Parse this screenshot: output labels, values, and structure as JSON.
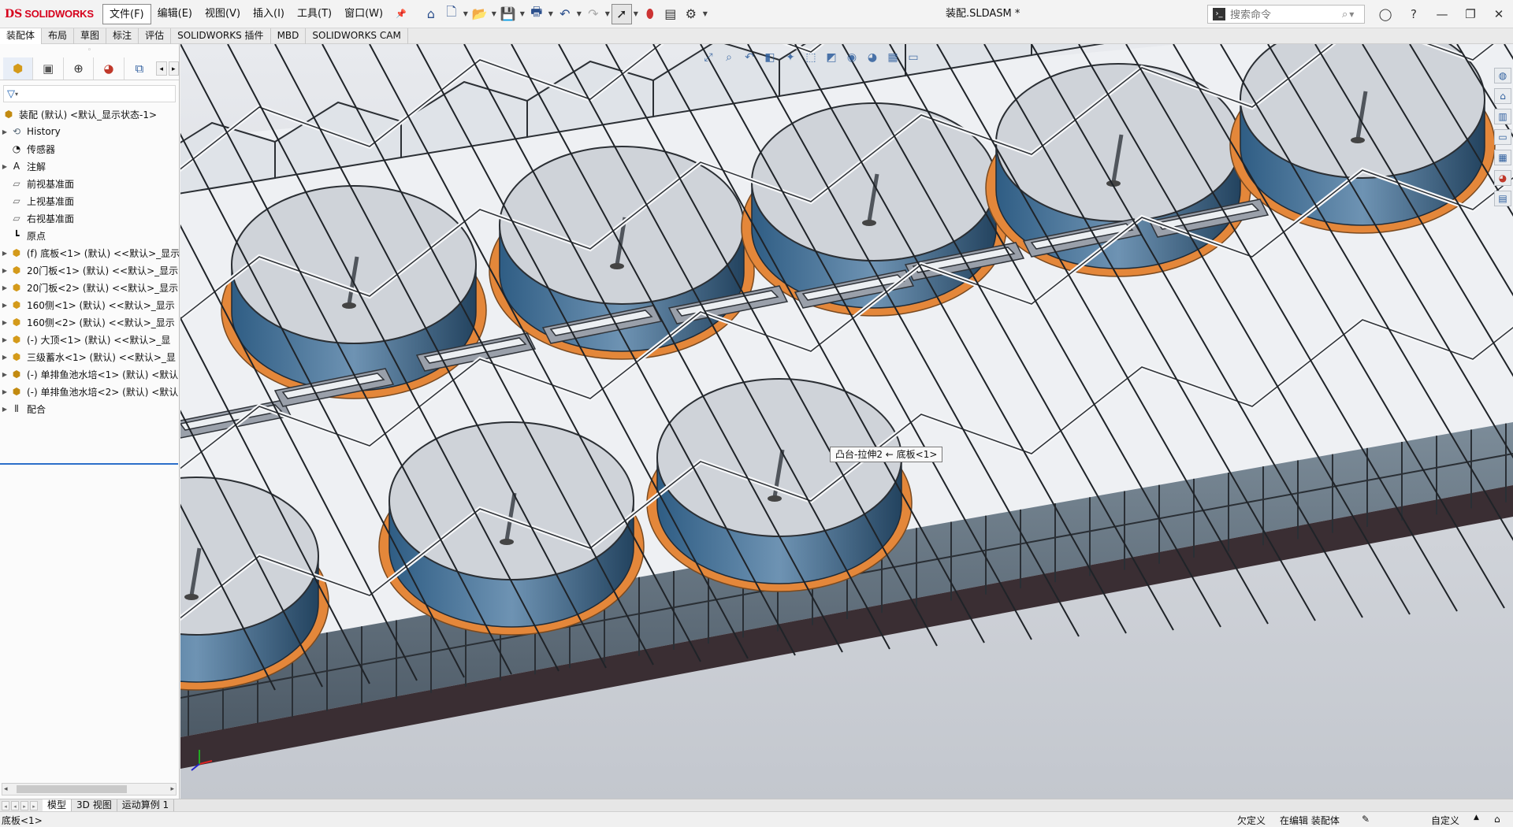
{
  "app": {
    "logo_ds": "DS",
    "logo_brand": "SOLIDWORKS",
    "document_title": "装配.SLDASM *"
  },
  "menu": [
    {
      "label": "文件(F)",
      "active": true
    },
    {
      "label": "编辑(E)"
    },
    {
      "label": "视图(V)"
    },
    {
      "label": "插入(I)"
    },
    {
      "label": "工具(T)"
    },
    {
      "label": "窗口(W)"
    }
  ],
  "search": {
    "placeholder": "搜索命令"
  },
  "command_tabs": [
    "装配体",
    "布局",
    "草图",
    "标注",
    "评估",
    "SOLIDWORKS 插件",
    "MBD",
    "SOLIDWORKS CAM"
  ],
  "tree": {
    "root": "装配 (默认) <默认_显示状态-1>",
    "items": [
      {
        "label": "History",
        "icon": "history-icon",
        "expandable": true
      },
      {
        "label": "传感器",
        "icon": "sensor-icon",
        "expandable": false
      },
      {
        "label": "注解",
        "icon": "annotation-icon",
        "expandable": true
      },
      {
        "label": "前视基准面",
        "icon": "plane-icon",
        "expandable": false
      },
      {
        "label": "上视基准面",
        "icon": "plane-icon",
        "expandable": false
      },
      {
        "label": "右视基准面",
        "icon": "plane-icon",
        "expandable": false
      },
      {
        "label": "原点",
        "icon": "origin-icon",
        "expandable": false
      },
      {
        "label": "(f) 底板<1> (默认) <<默认>_显示",
        "icon": "part-icon",
        "expandable": true
      },
      {
        "label": "20门板<1> (默认) <<默认>_显示",
        "icon": "part-icon",
        "expandable": true
      },
      {
        "label": "20门板<2> (默认) <<默认>_显示",
        "icon": "part-icon",
        "expandable": true
      },
      {
        "label": "160侧<1> (默认) <<默认>_显示",
        "icon": "part-icon",
        "expandable": true
      },
      {
        "label": "160侧<2> (默认) <<默认>_显示",
        "icon": "part-icon",
        "expandable": true
      },
      {
        "label": "(-) 大顶<1> (默认) <<默认>_显",
        "icon": "part-icon",
        "expandable": true
      },
      {
        "label": "三级蓄水<1> (默认) <<默认>_显",
        "icon": "part-icon",
        "expandable": true
      },
      {
        "label": "(-) 单排鱼池水培<1> (默认) <默认",
        "icon": "assembly-icon",
        "expandable": true
      },
      {
        "label": "(-) 单排鱼池水培<2> (默认) <默认",
        "icon": "assembly-icon",
        "expandable": true
      },
      {
        "label": "配合",
        "icon": "mates-icon",
        "expandable": true
      }
    ]
  },
  "viewport": {
    "tooltip": "凸台-拉伸2 ← 底板<1>"
  },
  "bottom_tabs": [
    "模型",
    "3D 视图",
    "运动算例 1"
  ],
  "status": {
    "selection": "底板<1>",
    "definition": "欠定义",
    "editing": "在编辑 装配体",
    "units": "自定义"
  },
  "colors": {
    "brand_red": "#d6001c",
    "accent_blue": "#2c6fc9",
    "tank_orange": "#e4873a",
    "tank_blue": "#3d6f98"
  }
}
